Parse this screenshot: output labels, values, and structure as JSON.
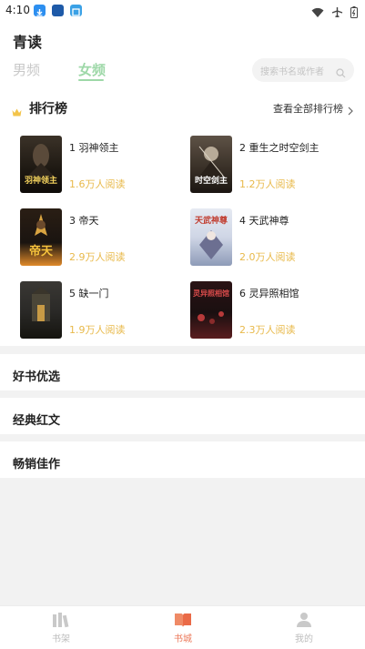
{
  "status_bar": {
    "time": "4:10",
    "app_icon_colors": [
      "#2d8ff0",
      "#1e5aa8",
      "#3aa1e6"
    ],
    "icons": [
      "download-icon",
      "app-icon",
      "app-icon",
      "wifi-icon",
      "airplane-icon",
      "battery-icon"
    ]
  },
  "header": {
    "app_title": "青读",
    "tabs": [
      {
        "label": "男频",
        "active": false
      },
      {
        "label": "女频",
        "active": true
      }
    ],
    "search_placeholder": "搜索书名或作者",
    "accent_color": "#9ed8a8"
  },
  "ranking": {
    "title": "排行榜",
    "view_all_label": "查看全部排行榜",
    "books": [
      {
        "title": "1 羽神领主",
        "reads": "1.6万人阅读",
        "cover_text": "羽神领主",
        "cover_text_color": "#f4d35e",
        "cover_bg": "#1d1812"
      },
      {
        "title": "2 重生之时空剑主",
        "reads": "1.2万人阅读",
        "cover_text": "时空剑主",
        "cover_text_color": "#ffffff",
        "cover_bg": "#3a3128"
      },
      {
        "title": "3 帝天",
        "reads": "2.9万人阅读",
        "cover_text": "帝天",
        "cover_text_color": "#f7c33c",
        "cover_bg": "#1a1410"
      },
      {
        "title": "4 天武神尊",
        "reads": "2.0万人阅读",
        "cover_text": "天武神尊",
        "cover_text_color": "#c0392b",
        "cover_bg": "#cfd6e6"
      },
      {
        "title": "5 缺一门",
        "reads": "1.9万人阅读",
        "cover_text": "",
        "cover_text_color": "#ffffff",
        "cover_bg": "#2b2a28"
      },
      {
        "title": "6 灵异照相馆",
        "reads": "2.3万人阅读",
        "cover_text": "灵异照相馆",
        "cover_text_color": "#d94b4b",
        "cover_bg": "#1a0f10"
      }
    ],
    "reads_color": "#e8b94a"
  },
  "sections": [
    "好书优选",
    "经典红文",
    "畅销佳作"
  ],
  "bottom_nav": [
    {
      "label": "书架",
      "icon": "bookshelf-icon",
      "active": false
    },
    {
      "label": "书城",
      "icon": "book-city-icon",
      "active": true
    },
    {
      "label": "我的",
      "icon": "profile-icon",
      "active": false
    }
  ]
}
